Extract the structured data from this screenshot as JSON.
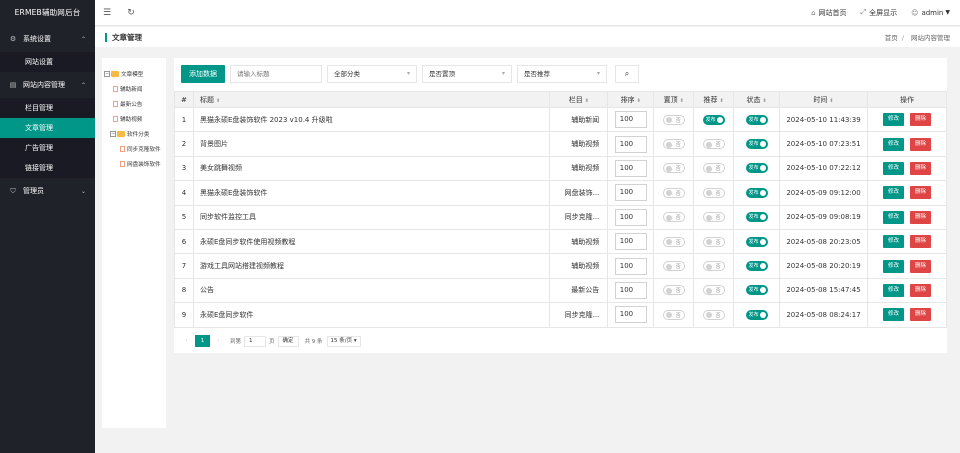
{
  "app": {
    "brand": "ERMEB辅助网后台"
  },
  "sidebar": {
    "groups": [
      {
        "label": "系统设置",
        "icon": "gear-icon",
        "items": [
          "网站设置"
        ]
      },
      {
        "label": "网站内容管理",
        "icon": "document-icon",
        "items": [
          "栏目管理",
          "文章管理",
          "广告管理",
          "链接管理"
        ]
      },
      {
        "label": "管理员",
        "icon": "shield-icon",
        "items": []
      }
    ],
    "active_item": "文章管理"
  },
  "topbar": {
    "site_home": "网站首页",
    "fullscreen": "全屏显示",
    "user": "admin"
  },
  "breadcrumb": {
    "page_title": "文章管理",
    "home": "首页",
    "current": "网站内容管理",
    "separator": "/"
  },
  "tree": {
    "nodes": [
      {
        "label": "文章模型",
        "type": "folder",
        "level": 0,
        "expander": "−"
      },
      {
        "label": "辅助新闻",
        "type": "file",
        "level": 1
      },
      {
        "label": "最新公告",
        "type": "file",
        "level": 1
      },
      {
        "label": "辅助视频",
        "type": "file",
        "level": 1
      },
      {
        "label": "软件分类",
        "type": "folder",
        "level": 1,
        "expander": "−"
      },
      {
        "label": "同步克隆软件",
        "type": "file",
        "level": 2
      },
      {
        "label": "网盘装饰软件",
        "type": "file",
        "level": 2
      }
    ]
  },
  "toolbar": {
    "add_button": "添加数据",
    "title_placeholder": "请输入标题",
    "category_select": "全部分类",
    "top_select": "是否置顶",
    "recommend_select": "是否推荐"
  },
  "table": {
    "columns": [
      "#",
      "标题",
      "栏目",
      "排序",
      "置顶",
      "推荐",
      "状态",
      "时间",
      "操作"
    ],
    "switch_off_text": "否",
    "switch_on_text": "发布",
    "edit_label": "修改",
    "delete_label": "删除",
    "rows": [
      {
        "no": "1",
        "title": "黑猫永硕E盘装饰软件 2023 v10.4 升级啦",
        "category": "辅助新闻",
        "sort": "100",
        "top": false,
        "recommend": true,
        "status": true,
        "time": "2024-05-10 11:43:39"
      },
      {
        "no": "2",
        "title": "背景图片",
        "category": "辅助视频",
        "sort": "100",
        "top": false,
        "recommend": false,
        "status": true,
        "time": "2024-05-10 07:23:51"
      },
      {
        "no": "3",
        "title": "美女跳舞视频",
        "category": "辅助视频",
        "sort": "100",
        "top": false,
        "recommend": false,
        "status": true,
        "time": "2024-05-10 07:22:12"
      },
      {
        "no": "4",
        "title": "黑猫永硕E盘装饰软件",
        "category": "网盘装饰...",
        "sort": "100",
        "top": false,
        "recommend": false,
        "status": true,
        "time": "2024-05-09 09:12:00"
      },
      {
        "no": "5",
        "title": "同步软件监控工具",
        "category": "同步克隆...",
        "sort": "100",
        "top": false,
        "recommend": false,
        "status": true,
        "time": "2024-05-09 09:08:19"
      },
      {
        "no": "6",
        "title": "永硕E盘同步软件使用视频教程",
        "category": "辅助视频",
        "sort": "100",
        "top": false,
        "recommend": false,
        "status": true,
        "time": "2024-05-08 20:23:05"
      },
      {
        "no": "7",
        "title": "游戏工具网站搭建视频教程",
        "category": "辅助视频",
        "sort": "100",
        "top": false,
        "recommend": false,
        "status": true,
        "time": "2024-05-08 20:20:19"
      },
      {
        "no": "8",
        "title": "公告",
        "category": "最新公告",
        "sort": "100",
        "top": false,
        "recommend": false,
        "status": true,
        "time": "2024-05-08 15:47:45"
      },
      {
        "no": "9",
        "title": "永硕E盘同步软件",
        "category": "同步克隆...",
        "sort": "100",
        "top": false,
        "recommend": false,
        "status": true,
        "time": "2024-05-08 08:24:17"
      }
    ]
  },
  "pager": {
    "current_page": "1",
    "goto_label": "到第",
    "page_input": "1",
    "page_unit": "页",
    "confirm": "确定",
    "total": "共 9 条",
    "page_size": "15 条/页"
  },
  "colors": {
    "accent": "#009688",
    "danger": "#e04545",
    "sidebar_bg": "#20222a"
  }
}
